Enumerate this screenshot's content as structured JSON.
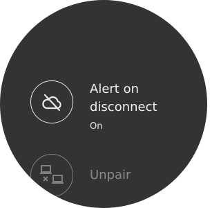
{
  "settings": {
    "alert": {
      "title": "Alert on disconnect",
      "status": "On",
      "icon": "cloud-off-icon"
    },
    "unpair": {
      "label": "Unpair",
      "icon": "devices-unlink-icon"
    }
  },
  "colors": {
    "background": "#333333",
    "text_primary": "#f0f0f0",
    "text_disabled": "#8a8a8a",
    "icon_outline": "#e8e8e8"
  }
}
